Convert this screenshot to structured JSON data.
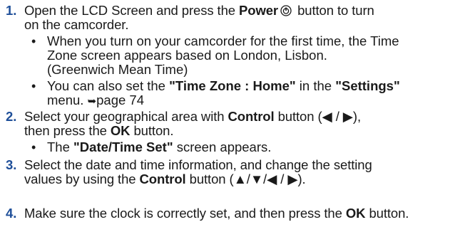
{
  "accent_color": "#1f4f99",
  "steps": [
    {
      "num": "1.",
      "a": "Open the LCD Screen and press the ",
      "b": "Power",
      "c": " button to turn",
      "d": "on the camcorder.",
      "icon": "power-icon"
    },
    {
      "num": "2.",
      "line1a": "Select your geographical area with ",
      "line1b": "Control",
      "line1c": " button (◀ / ▶),",
      "line2a": "then press the ",
      "line2b": "OK",
      "line2c": " button."
    },
    {
      "num": "3.",
      "line1": "Select the date and time information, and change the setting",
      "line2a": "values by using the ",
      "line2b": "Control",
      "line2c": " button (▲/▼/◀ / ▶)."
    },
    {
      "num": "4.",
      "line1a": "Make sure the clock is correctly set, and then press the ",
      "line1b": "OK",
      "line1c": " button."
    }
  ],
  "bullets": {
    "symbol": "•",
    "b1_line1": "When you turn on your camcorder for the first time, the Time",
    "b1_line2": "Zone screen appears based on London, Lisbon.",
    "b1_line3": "(Greenwich Mean Time)",
    "b2_line1a": "You can also set the ",
    "b2_line1b": "\"Time Zone : Home\"",
    "b2_line1c": " in the ",
    "b2_line1d": "\"Settings\"",
    "b2_line2a": "menu. ",
    "b2_arrow": "➥",
    "b2_line2b": "page 74",
    "b3a": "The ",
    "b3b": "\"Date/Time Set\"",
    "b3c": " screen appears."
  }
}
